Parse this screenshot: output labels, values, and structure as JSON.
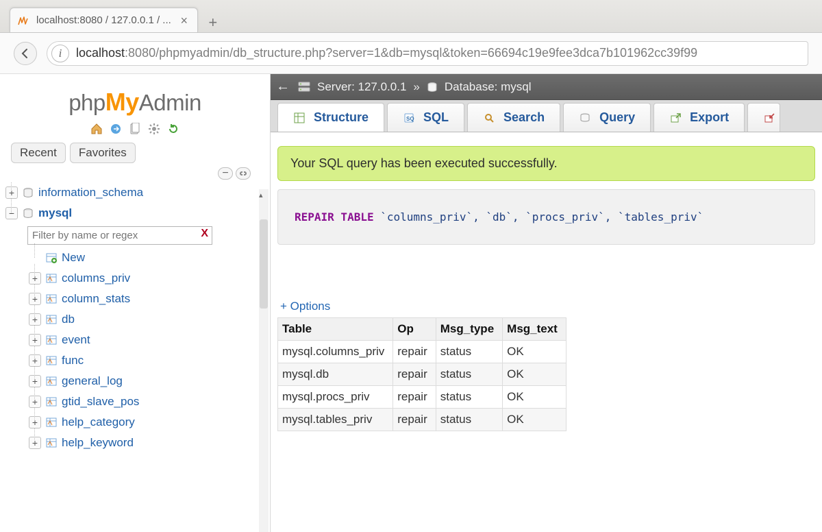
{
  "browser": {
    "tab_title": "localhost:8080 / 127.0.0.1 / ...",
    "url_prefix": "localhost",
    "url_rest": ":8080/phpmyadmin/db_structure.php?server=1&db=mysql&token=66694c19e9fee3dca7b101962cc39f99"
  },
  "logo": {
    "seg1": "php",
    "seg2": "My",
    "seg3": "Admin"
  },
  "sidebar": {
    "recent_label": "Recent",
    "favorites_label": "Favorites",
    "filter_placeholder": "Filter by name or regex",
    "filter_clear": "X",
    "new_label": "New",
    "databases": [
      {
        "name": "information_schema",
        "collapsed": true,
        "current": false
      },
      {
        "name": "mysql",
        "collapsed": false,
        "current": true
      }
    ],
    "tables": [
      "columns_priv",
      "column_stats",
      "db",
      "event",
      "func",
      "general_log",
      "gtid_slave_pos",
      "help_category",
      "help_keyword"
    ]
  },
  "breadcrumb": {
    "server_label": "Server: 127.0.0.1",
    "separator": "»",
    "db_label": "Database: mysql"
  },
  "tabs": {
    "structure": "Structure",
    "sql": "SQL",
    "search": "Search",
    "query": "Query",
    "export": "Export"
  },
  "flash_message": "Your SQL query has been executed successfully.",
  "sql": {
    "keywords": "REPAIR TABLE",
    "identifiers": " `columns_priv`, `db`, `procs_priv`, `tables_priv`"
  },
  "options_link": "+ Options",
  "result_headers": {
    "table": "Table",
    "op": "Op",
    "msg_type": "Msg_type",
    "msg_text": "Msg_text"
  },
  "result_rows": [
    {
      "table": "mysql.columns_priv",
      "op": "repair",
      "msg_type": "status",
      "msg_text": "OK"
    },
    {
      "table": "mysql.db",
      "op": "repair",
      "msg_type": "status",
      "msg_text": "OK"
    },
    {
      "table": "mysql.procs_priv",
      "op": "repair",
      "msg_type": "status",
      "msg_text": "OK"
    },
    {
      "table": "mysql.tables_priv",
      "op": "repair",
      "msg_type": "status",
      "msg_text": "OK"
    }
  ]
}
